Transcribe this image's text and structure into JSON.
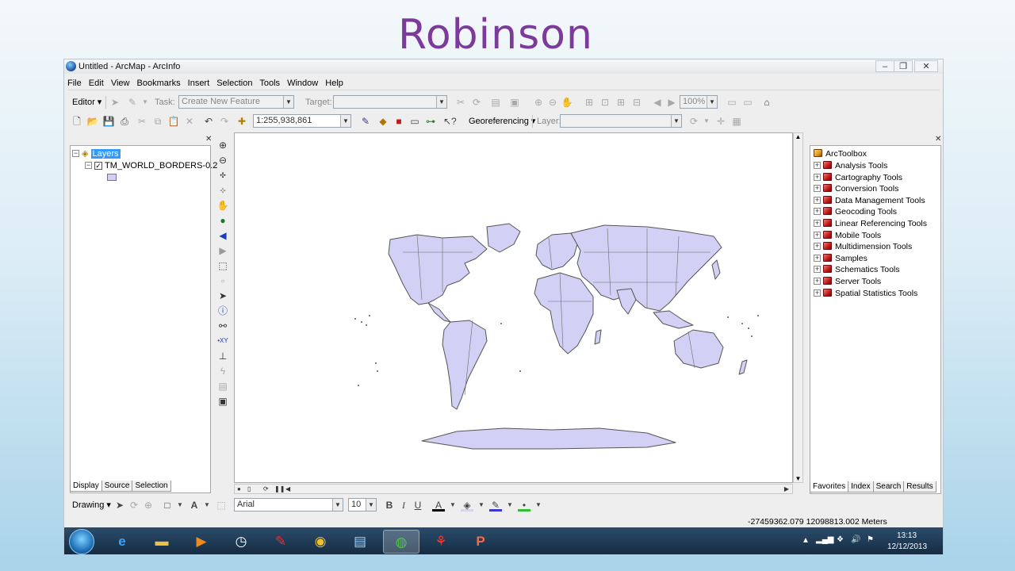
{
  "slide": {
    "title": "Robinson"
  },
  "window": {
    "title": "Untitled - ArcMap - ArcInfo"
  },
  "menu": [
    "File",
    "Edit",
    "View",
    "Bookmarks",
    "Insert",
    "Selection",
    "Tools",
    "Window",
    "Help"
  ],
  "editor_toolbar": {
    "editor_label": "Editor",
    "task_label": "Task:",
    "task_value": "Create New Feature",
    "target_label": "Target:",
    "zoom_value": "100%"
  },
  "standard_toolbar": {
    "scale_value": "1:255,938,861",
    "georeferencing_label": "Georeferencing",
    "layer_label": "Layer:"
  },
  "toc": {
    "root_label": "Layers",
    "layer_name": "TM_WORLD_BORDERS-0.2",
    "tabs": [
      "Display",
      "Source",
      "Selection"
    ],
    "fill_color": "#d3d0f5"
  },
  "arctoolbox": {
    "root_label": "ArcToolbox",
    "items": [
      "Analysis Tools",
      "Cartography Tools",
      "Conversion Tools",
      "Data Management Tools",
      "Geocoding Tools",
      "Linear Referencing Tools",
      "Mobile Tools",
      "Multidimension Tools",
      "Samples",
      "Schematics Tools",
      "Server Tools",
      "Spatial Statistics Tools"
    ],
    "tabs": [
      "Favorites",
      "Index",
      "Search",
      "Results"
    ]
  },
  "drawing_toolbar": {
    "drawing_label": "Drawing",
    "font_value": "Arial",
    "size_value": "10",
    "bold": "B",
    "italic": "I",
    "underline": "U"
  },
  "status": {
    "coordinates": "-27459362.079  12098813.002 Meters"
  },
  "clock": {
    "time": "13:13",
    "date": "12/12/2013"
  },
  "colors": {
    "title_purple": "#7c3a9a",
    "selection_blue": "#3399ff",
    "map_fill": "#d3d0f5"
  }
}
